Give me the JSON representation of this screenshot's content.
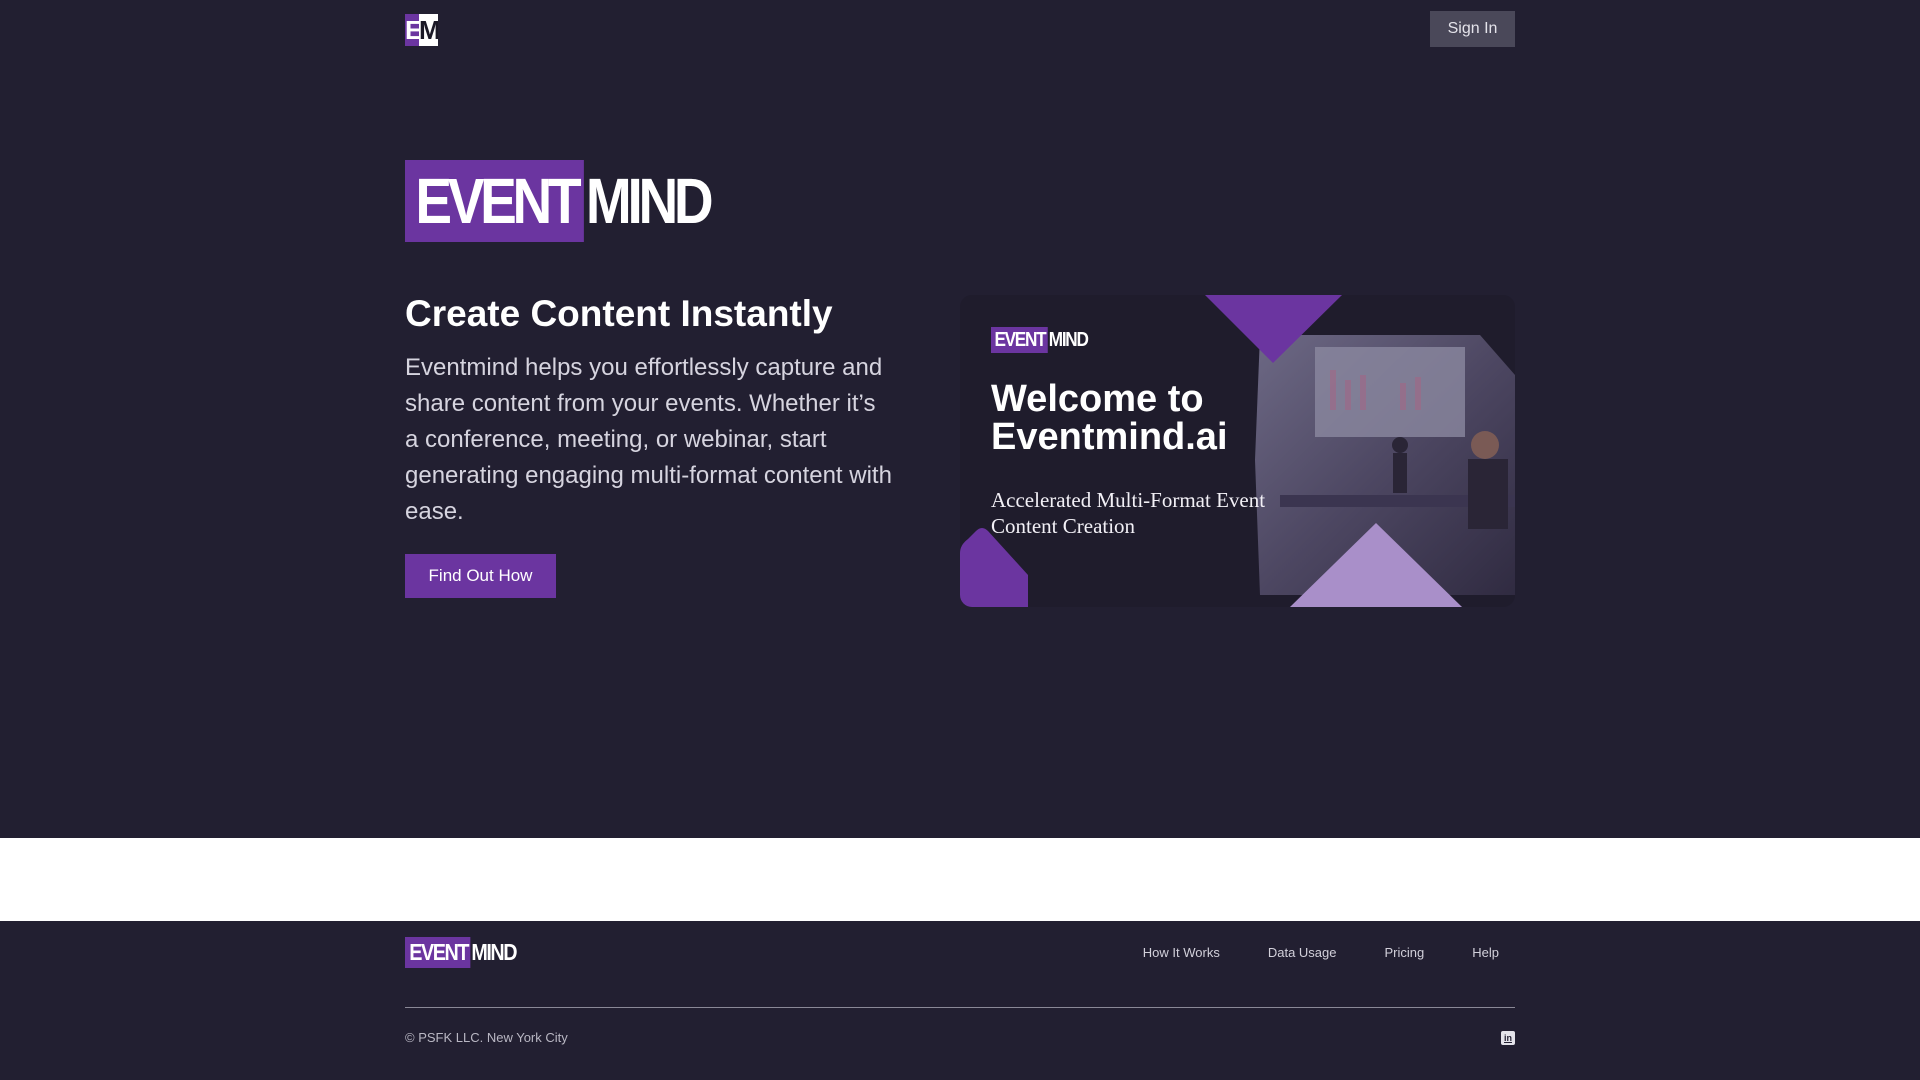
{
  "header": {
    "logo_mark": {
      "left": "E",
      "right": "M"
    },
    "signin_label": "Sign In"
  },
  "hero": {
    "logo": {
      "part1": "EVENT",
      "part2": "MIND"
    },
    "title": "Create Content Instantly",
    "description": "Eventmind helps you effortlessly capture and share content from your events. Whether it’s a conference, meeting, or webinar, start generating engaging multi-format content with ease.",
    "cta_label": "Find Out How"
  },
  "banner": {
    "logo": {
      "part1": "EVENT",
      "part2": "MIND"
    },
    "title": "Welcome to Eventmind.ai",
    "subtitle": "Accelerated Multi-Format Event Content Creation"
  },
  "footer": {
    "logo": {
      "part1": "EVENT",
      "part2": "MIND"
    },
    "nav": [
      "How It Works",
      "Data Usage",
      "Pricing",
      "Help"
    ],
    "copyright": "© PSFK LLC. New York City",
    "social_icon": "linkedin-icon"
  },
  "colors": {
    "background": "#221f31",
    "brand_purple": "#6b35a0",
    "light_purple": "#a98fc9",
    "signin_bg": "#4a4859"
  }
}
